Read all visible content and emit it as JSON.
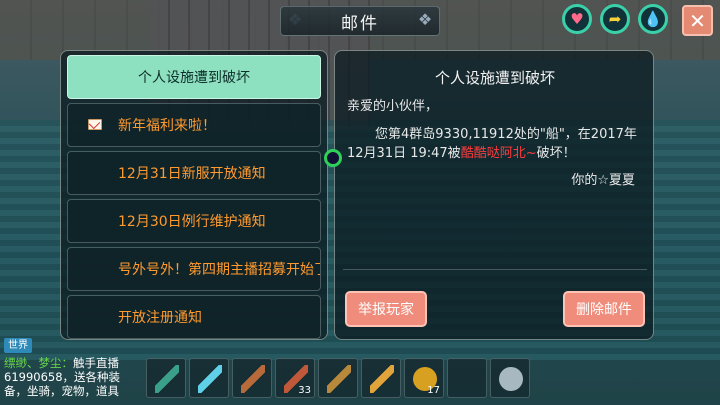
{
  "header": {
    "title": "邮件"
  },
  "top_buttons": [
    {
      "name": "heart-button",
      "icon": "heart-icon",
      "glyph": "♥",
      "color": "#ff6a8a"
    },
    {
      "name": "arrow-button",
      "icon": "arrow-icon",
      "glyph": "➦",
      "color": "#f5d23a"
    },
    {
      "name": "drop-button",
      "icon": "water-drop-icon",
      "glyph": "💧",
      "color": "#37c9e8"
    }
  ],
  "close_label": "✕",
  "mail_list": [
    {
      "label": "个人设施遭到破坏",
      "active": true,
      "has_icon": false
    },
    {
      "label": "新年福利来啦！",
      "active": false,
      "has_icon": true
    },
    {
      "label": "12月31日新服开放通知",
      "active": false,
      "has_icon": false
    },
    {
      "label": "12月30日例行维护通知",
      "active": false,
      "has_icon": false
    },
    {
      "label": "号外号外！第四期主播招募开始了",
      "active": false,
      "has_icon": false
    },
    {
      "label": "开放注册通知",
      "active": false,
      "has_icon": false
    }
  ],
  "detail": {
    "title": "个人设施遭到破坏",
    "greeting": "亲爱的小伙伴，",
    "body_before": "您第4群岛9330,11912处的\"船\"，在2017年12月31日 19:47被",
    "body_name": "酷酷哒阿北~",
    "body_after": "破坏！",
    "signature": "你的☆夏夏",
    "report_button": "举报玩家",
    "delete_button": "删除邮件"
  },
  "chat": {
    "channel": "世界",
    "sender": "缥缈、梦尘：",
    "message": "触手直播61990658，送各种装备，坐骑，宠物，道具"
  },
  "hotbar": [
    {
      "icon": "staff-icon",
      "count": ""
    },
    {
      "icon": "trident-icon",
      "count": ""
    },
    {
      "icon": "bow-icon",
      "count": ""
    },
    {
      "icon": "rope-icon",
      "count": "33"
    },
    {
      "icon": "fishing-rod-icon",
      "count": ""
    },
    {
      "icon": "banana-icon",
      "count": ""
    },
    {
      "icon": "soup-bowl-icon",
      "count": "17"
    },
    {
      "icon": "empty-slot",
      "count": ""
    },
    {
      "icon": "disc-icon",
      "count": ""
    }
  ]
}
